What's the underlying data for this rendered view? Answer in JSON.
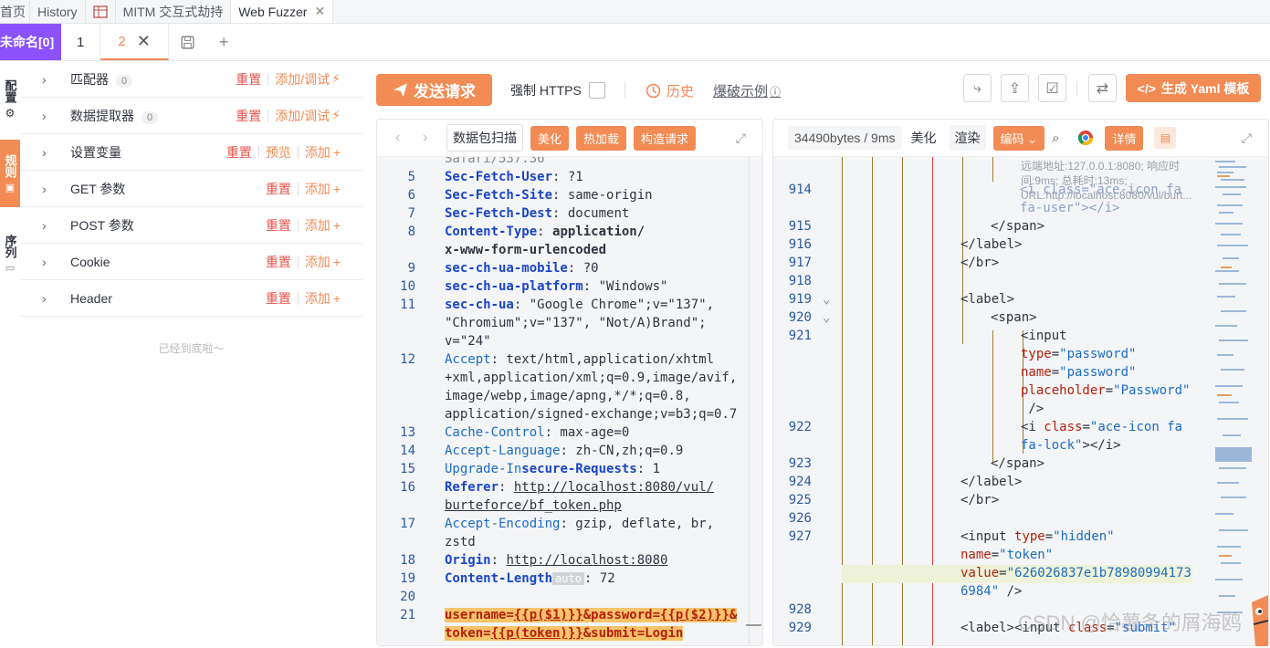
{
  "top_tabs": [
    {
      "label": "首页"
    },
    {
      "label": "History"
    },
    {
      "label": "MITM 交互式劫持"
    },
    {
      "label": "Web Fuzzer"
    }
  ],
  "fuzzer_tabs": {
    "unnamed": "未命名[0]",
    "tab1": "1",
    "tab2": "2"
  },
  "side_tabs": {
    "config": "配置",
    "rules": "规则",
    "sequence": "序列"
  },
  "left_panel": {
    "rows": [
      {
        "name": "匹配器",
        "count": "0",
        "reset": "重置",
        "action": "添加/调试"
      },
      {
        "name": "数据提取器",
        "count": "0",
        "reset": "重置",
        "action": "添加/调试"
      },
      {
        "name": "设置变量",
        "reset": "重置",
        "preview": "预览",
        "action": "添加"
      },
      {
        "name": "GET 参数",
        "reset": "重置",
        "action": "添加"
      },
      {
        "name": "POST 参数",
        "reset": "重置",
        "action": "添加"
      },
      {
        "name": "Cookie",
        "reset": "重置",
        "action": "添加"
      },
      {
        "name": "Header",
        "reset": "重置",
        "action": "添加"
      }
    ],
    "bottom_tip": "已经到底啦～"
  },
  "toolbar": {
    "send": "发送请求",
    "force_https": "强制 HTTPS",
    "history": "历史",
    "example": "爆破示例",
    "yaml": "生成 Yaml 模板"
  },
  "request_editor": {
    "scan": "数据包扫描",
    "beautify": "美化",
    "hot_load": "热加载",
    "build": "构造请求"
  },
  "response_editor": {
    "stats": "34490bytes / 9ms",
    "beautify": "美化",
    "render": "渲染",
    "encode": "编码",
    "detail": "详情",
    "hover_tip": "远端地址:127.0.0.1:8080; 响应时间:9ms; 总耗时:13ms; URL:http://localhost:8080/vul/burt..."
  },
  "watermark": "CSDN @恰薯条的屑海鸥",
  "colors": {
    "accent": "#f28b54",
    "purple": "#8c52ff",
    "red": "#e5534b"
  }
}
